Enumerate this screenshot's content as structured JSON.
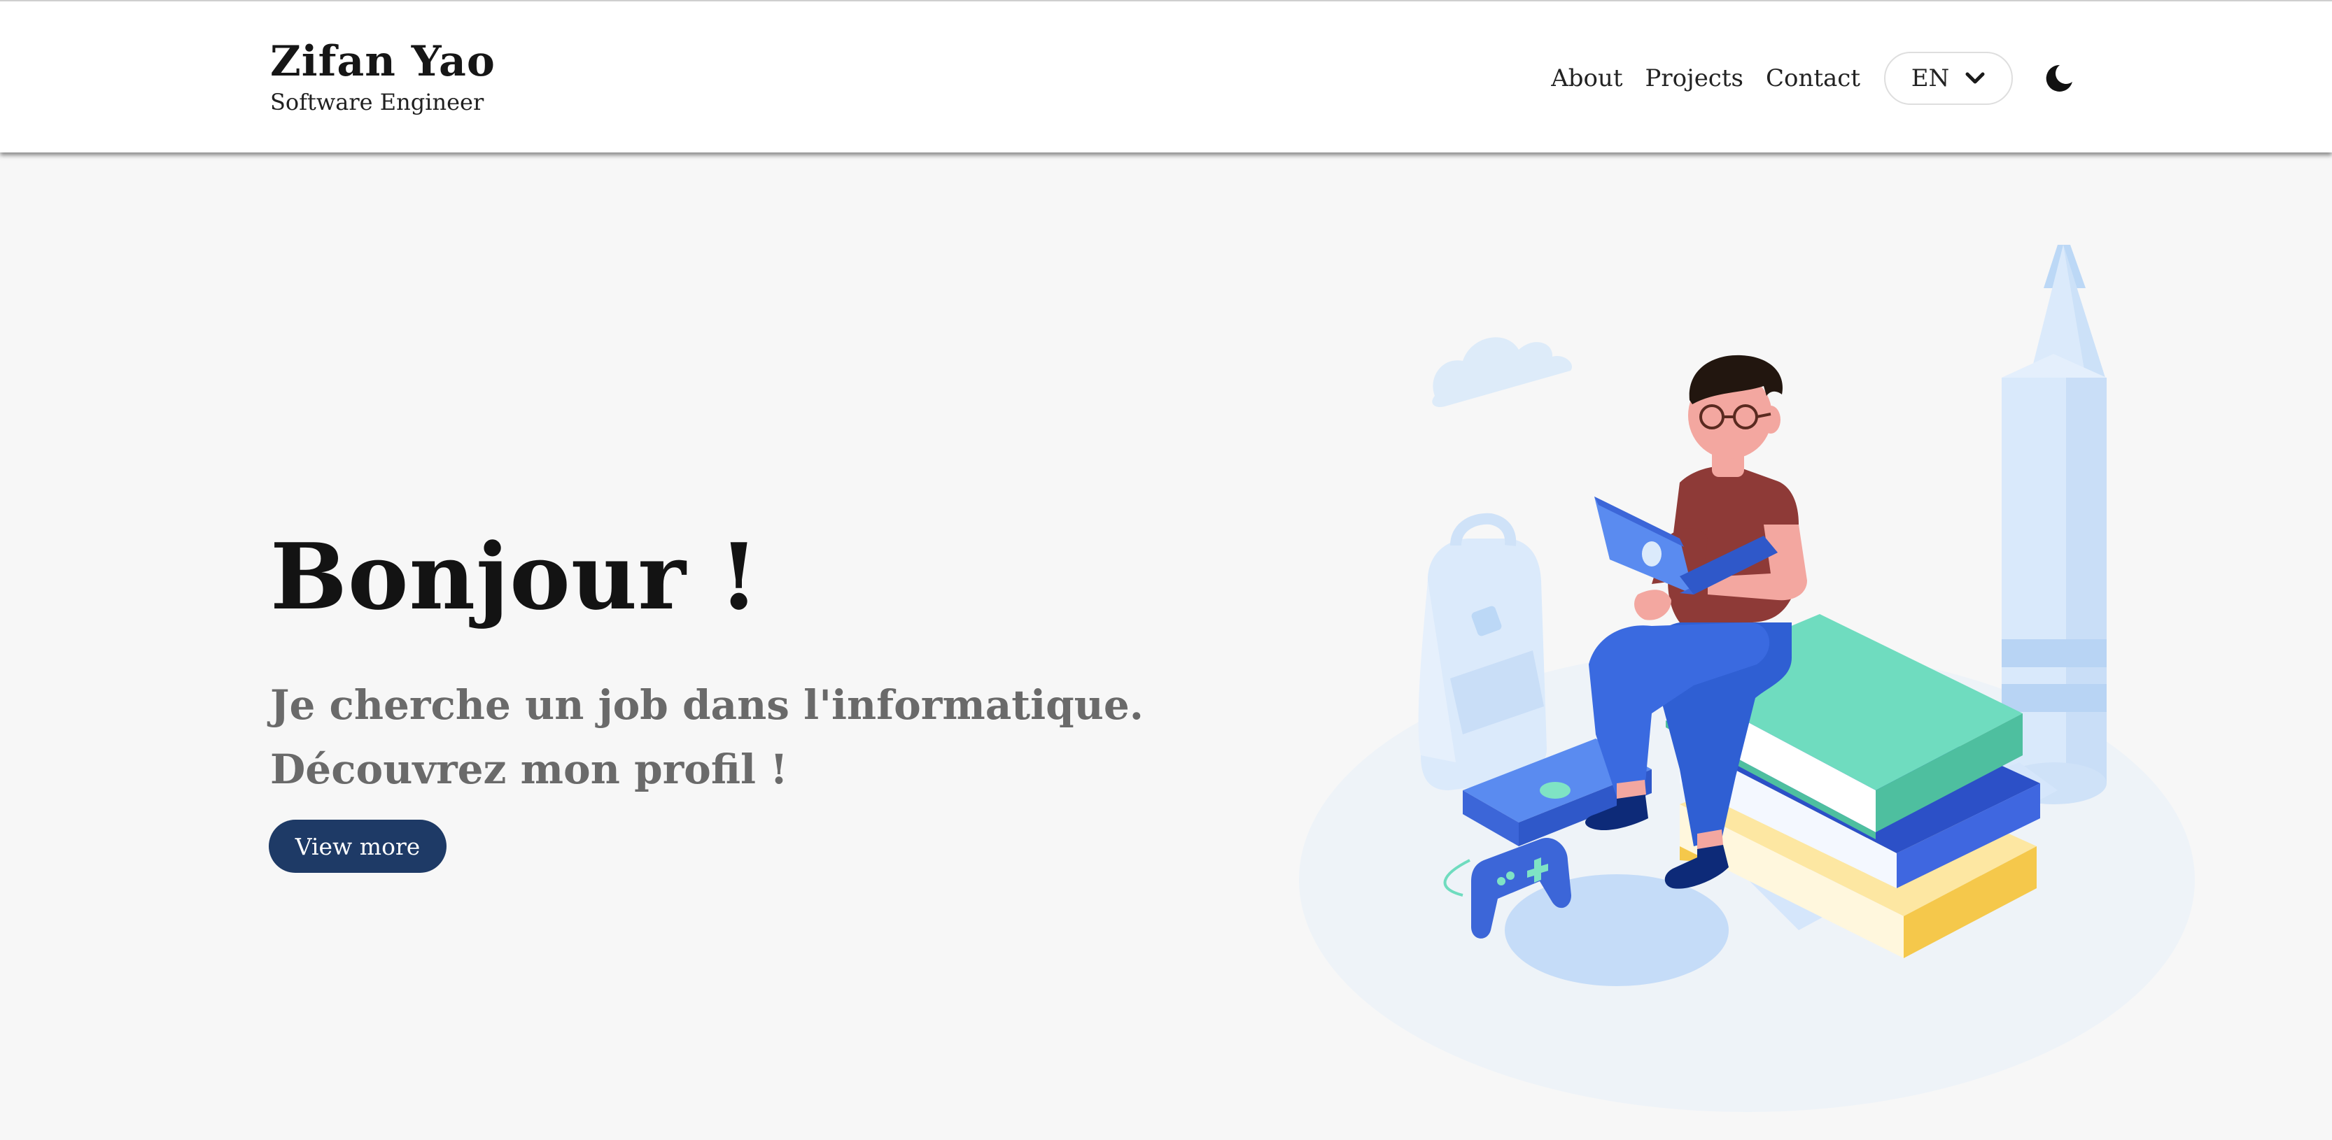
{
  "header": {
    "name": "Zifan Yao",
    "tagline": "Software Engineer",
    "nav": {
      "about": "About",
      "projects": "Projects",
      "contact": "Contact"
    },
    "language": "EN",
    "theme_icon": "moon-icon"
  },
  "hero": {
    "title": "Bonjour !",
    "subtitle_line1": "Je cherche un job dans l'informatique.",
    "subtitle_line2": "Découvrez mon profil !",
    "button_label": "View more"
  },
  "colors": {
    "accent": "#1e3a66",
    "subtitle": "#6a6a6a",
    "background": "#f7f7f7"
  }
}
